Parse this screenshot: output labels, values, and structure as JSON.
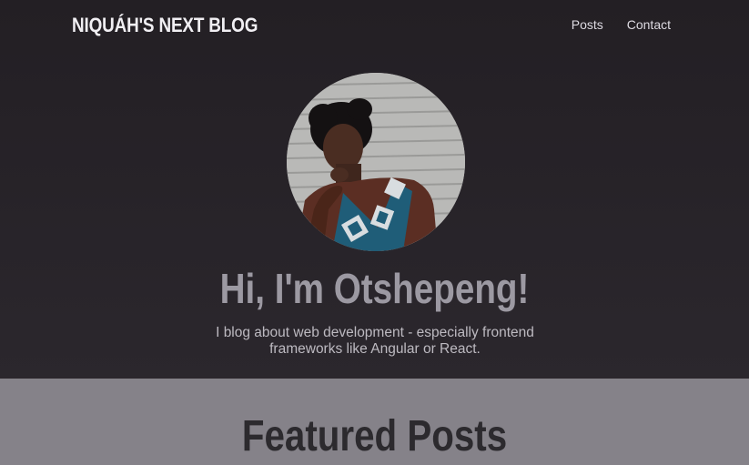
{
  "header": {
    "logo": "NIQUÁH'S NEXT BLOG",
    "nav": [
      {
        "label": "Posts"
      },
      {
        "label": "Contact"
      }
    ]
  },
  "hero": {
    "avatar_icon": "profile-photo",
    "title": "Hi, I'm Otshepeng!",
    "subtitle": "I blog about web development - especially frontend frameworks like Angular or React."
  },
  "featured": {
    "title": "Featured Posts"
  },
  "colors": {
    "hero_bg": "#27232a",
    "featured_bg": "#858289",
    "title_text": "#9c99a2"
  }
}
